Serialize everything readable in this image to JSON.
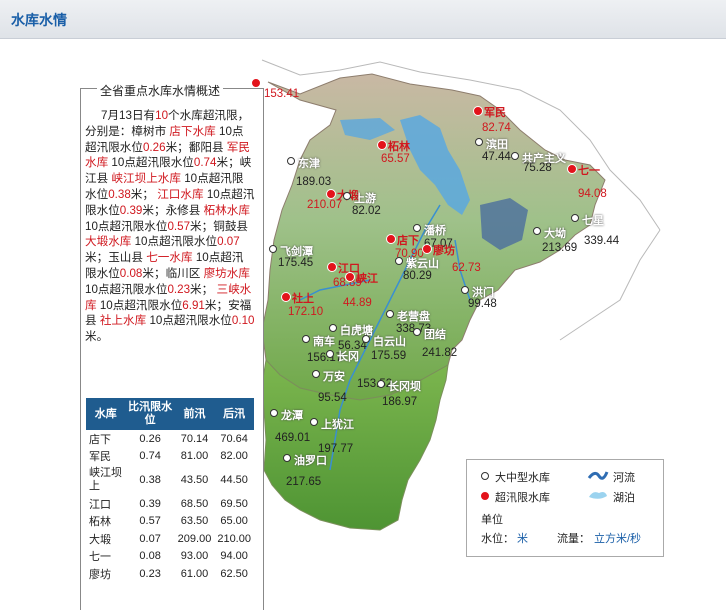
{
  "header": {
    "title": "水库水情"
  },
  "panel": {
    "title": "全省重点水库水情概述",
    "summary": [
      {
        "t": "7月13日有",
        "c": "n"
      },
      {
        "t": "10",
        "c": "r"
      },
      {
        "t": "个水库超汛限，分别是：樟树市 ",
        "c": "n"
      },
      {
        "t": "店下水库",
        "c": "r"
      },
      {
        "t": " 10点超汛限水位",
        "c": "n"
      },
      {
        "t": "0.26",
        "c": "r"
      },
      {
        "t": "米；鄱阳县 ",
        "c": "n"
      },
      {
        "t": "军民水库",
        "c": "r"
      },
      {
        "t": " 10点超汛限水位",
        "c": "n"
      },
      {
        "t": "0.74",
        "c": "r"
      },
      {
        "t": "米；峡江县 ",
        "c": "n"
      },
      {
        "t": "峡江坝上水库",
        "c": "r"
      },
      {
        "t": " 10点超汛限水位",
        "c": "n"
      },
      {
        "t": "0.38",
        "c": "r"
      },
      {
        "t": "米； ",
        "c": "n"
      },
      {
        "t": "江口水库",
        "c": "r"
      },
      {
        "t": " 10点超汛限水位",
        "c": "n"
      },
      {
        "t": "0.39",
        "c": "r"
      },
      {
        "t": "米；永修县 ",
        "c": "n"
      },
      {
        "t": "柘林水库",
        "c": "r"
      },
      {
        "t": " 10点超汛限水位",
        "c": "n"
      },
      {
        "t": "0.57",
        "c": "r"
      },
      {
        "t": "米；铜鼓县 ",
        "c": "n"
      },
      {
        "t": "大塅水库",
        "c": "r"
      },
      {
        "t": " 10点超汛限水位",
        "c": "n"
      },
      {
        "t": "0.07",
        "c": "r"
      },
      {
        "t": "米；玉山县 ",
        "c": "n"
      },
      {
        "t": "七一水库",
        "c": "r"
      },
      {
        "t": " 10点超汛限水位",
        "c": "n"
      },
      {
        "t": "0.08",
        "c": "r"
      },
      {
        "t": "米；临川区 ",
        "c": "n"
      },
      {
        "t": "廖坊水库",
        "c": "r"
      },
      {
        "t": " 10点超汛限水位",
        "c": "n"
      },
      {
        "t": "0.23",
        "c": "r"
      },
      {
        "t": "米； ",
        "c": "n"
      },
      {
        "t": "三峡水库",
        "c": "r"
      },
      {
        "t": " 10点超汛限水位",
        "c": "n"
      },
      {
        "t": "6.91",
        "c": "r"
      },
      {
        "t": "米；安福县 ",
        "c": "n"
      },
      {
        "t": "社上水库",
        "c": "r"
      },
      {
        "t": " 10点超汛限水位",
        "c": "n"
      },
      {
        "t": "0.10",
        "c": "r"
      },
      {
        "t": "米。",
        "c": "n"
      }
    ]
  },
  "table": {
    "headers": [
      "水库",
      "比汛限水位",
      "前汛",
      "后汛"
    ],
    "rows": [
      [
        "店下",
        "0.26",
        "70.14",
        "70.64"
      ],
      [
        "军民",
        "0.74",
        "81.00",
        "82.00"
      ],
      [
        "峡江坝上",
        "0.38",
        "43.50",
        "44.50"
      ],
      [
        "江口",
        "0.39",
        "68.50",
        "69.50"
      ],
      [
        "柘林",
        "0.57",
        "63.50",
        "65.00"
      ],
      [
        "大塅",
        "0.07",
        "209.00",
        "210.00"
      ],
      [
        "七一",
        "0.08",
        "93.00",
        "94.00"
      ],
      [
        "廖坊",
        "0.23",
        "61.00",
        "62.50"
      ]
    ]
  },
  "reservoirs": [
    {
      "name": "",
      "value": "153.41",
      "over": true
    },
    {
      "name": "军民",
      "value": "82.74",
      "over": true
    },
    {
      "name": "滨田",
      "value": "47.44",
      "over": false
    },
    {
      "name": "柘林",
      "value": "65.57",
      "over": true
    },
    {
      "name": "共产主义",
      "value": "75.28",
      "over": false
    },
    {
      "name": "东津",
      "value": "189.03",
      "over": false
    },
    {
      "name": "大塅",
      "value": "210.07",
      "over": true
    },
    {
      "name": "上游",
      "value": "82.02",
      "over": false
    },
    {
      "name": "七一",
      "value": "94.08",
      "over": true
    },
    {
      "name": "七星",
      "value": "339.44",
      "over": false
    },
    {
      "name": "大坳",
      "value": "213.69",
      "over": false
    },
    {
      "name": "飞剑潭",
      "value": "175.45",
      "over": false
    },
    {
      "name": "潘桥",
      "value": "67.07",
      "over": false
    },
    {
      "name": "店下",
      "value": "70.90",
      "over": true
    },
    {
      "name": "紫云山",
      "value": "80.29",
      "over": false
    },
    {
      "name": "廖坊",
      "value": "62.73",
      "over": true
    },
    {
      "name": "江口",
      "value": "68.89",
      "over": true
    },
    {
      "name": "峡江",
      "value": "44.89",
      "over": true
    },
    {
      "name": "洪门",
      "value": "99.48",
      "over": false
    },
    {
      "name": "社上",
      "value": "172.10",
      "over": true
    },
    {
      "name": "老营盘",
      "value": "338.73",
      "over": false
    },
    {
      "name": "南车",
      "value": "156.17",
      "over": false
    },
    {
      "name": "白虎塘",
      "value": "56.34",
      "over": false
    },
    {
      "name": "白云山",
      "value": "175.59",
      "over": false
    },
    {
      "name": "团结",
      "value": "241.82",
      "over": false
    },
    {
      "name": "长冈",
      "value": "153.52",
      "over": false
    },
    {
      "name": "万安",
      "value": "95.54",
      "over": false
    },
    {
      "name": "长冈坝",
      "value": "186.97",
      "over": false
    },
    {
      "name": "龙潭",
      "value": "469.01",
      "over": false
    },
    {
      "name": "上犹江",
      "value": "197.77",
      "over": false
    },
    {
      "name": "油罗口",
      "value": "217.65",
      "over": false
    }
  ],
  "legend": {
    "medium_large": "大中型水库",
    "over_limit": "超汛限水库",
    "river": "河流",
    "lake": "湖泊",
    "unit_title": "单位",
    "level_label": "水位：",
    "level_unit": "米",
    "flow_label": "流量：",
    "flow_unit": "立方米/秒"
  },
  "colors": {
    "over": "#e3131b",
    "header_bg": "#1f5c8f",
    "link": "#1a5fa8"
  }
}
